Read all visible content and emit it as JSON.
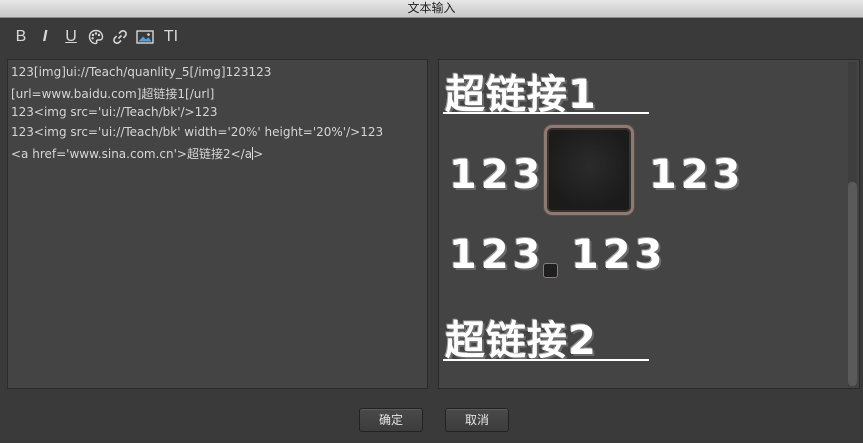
{
  "window": {
    "title": "文本输入"
  },
  "toolbar": {
    "bold_label": "B",
    "italic_label": "I",
    "underline_label": "U",
    "color_icon": "palette-icon",
    "link_icon": "link-icon",
    "image_icon": "image-icon",
    "fontsize_label": "TI"
  },
  "editor": {
    "lines": [
      "123[img]ui://Teach/quanlity_5[/img]123123",
      "[url=www.baidu.com]超链接1[/url]",
      "123<img src='ui://Teach/bk'/>123",
      "123<img src='ui://Teach/bk' width='20%' height='20%'/>123",
      "<a href='www.sina.com.cn'>超链接2</a",
      ">"
    ]
  },
  "preview": {
    "link1": "超链接1",
    "row1_left": "123",
    "row1_right": "123",
    "row2_left": "123",
    "row2_right": "123",
    "link2": "超链接2"
  },
  "buttons": {
    "ok": "确定",
    "cancel": "取消"
  }
}
